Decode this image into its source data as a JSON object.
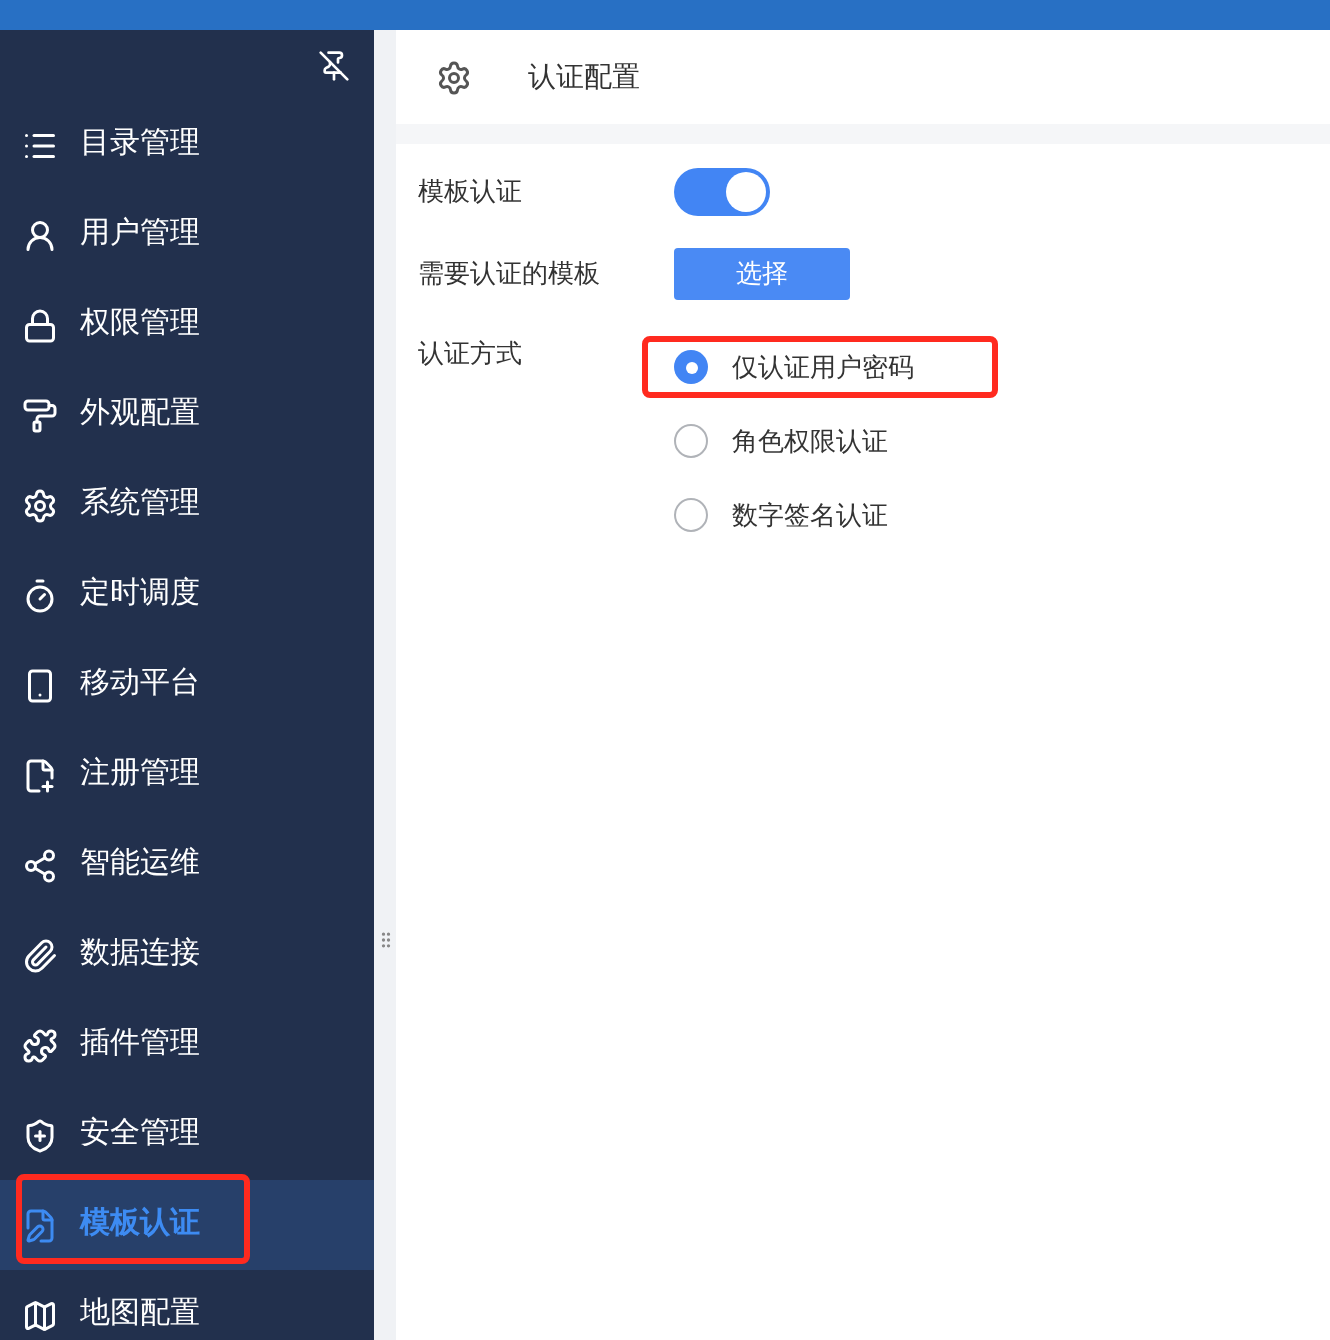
{
  "sidebar": {
    "items": [
      {
        "label": "目录管理",
        "selected": false,
        "annotated": false
      },
      {
        "label": "用户管理",
        "selected": false,
        "annotated": false
      },
      {
        "label": "权限管理",
        "selected": false,
        "annotated": false
      },
      {
        "label": "外观配置",
        "selected": false,
        "annotated": false
      },
      {
        "label": "系统管理",
        "selected": false,
        "annotated": false
      },
      {
        "label": "定时调度",
        "selected": false,
        "annotated": false
      },
      {
        "label": "移动平台",
        "selected": false,
        "annotated": false
      },
      {
        "label": "注册管理",
        "selected": false,
        "annotated": false
      },
      {
        "label": "智能运维",
        "selected": false,
        "annotated": false
      },
      {
        "label": "数据连接",
        "selected": false,
        "annotated": false
      },
      {
        "label": "插件管理",
        "selected": false,
        "annotated": false
      },
      {
        "label": "安全管理",
        "selected": false,
        "annotated": false
      },
      {
        "label": "模板认证",
        "selected": true,
        "annotated": true
      },
      {
        "label": "地图配置",
        "selected": false,
        "annotated": false
      }
    ]
  },
  "header": {
    "title": "认证配置"
  },
  "form": {
    "toggle": {
      "label": "模板认证",
      "on": true
    },
    "template": {
      "label": "需要认证的模板",
      "button": "选择"
    },
    "method": {
      "label": "认证方式",
      "options": [
        {
          "label": "仅认证用户密码",
          "selected": true,
          "annotated": true
        },
        {
          "label": "角色权限认证",
          "selected": false,
          "annotated": false
        },
        {
          "label": "数字签名认证",
          "selected": false,
          "annotated": false
        }
      ]
    }
  }
}
